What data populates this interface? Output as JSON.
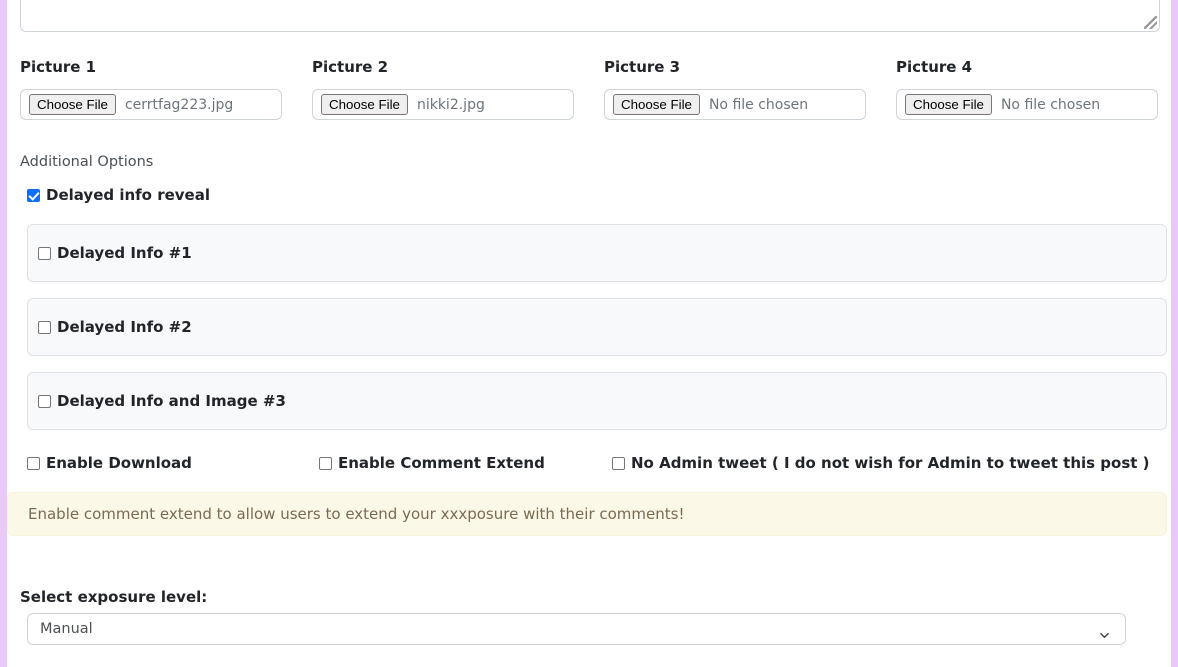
{
  "theme": {
    "page_border_color": "#e8c9f7",
    "accent_checkbox_color": "#0d6efd",
    "panel_bg": "#f8f9fa",
    "panel_border": "#dee2e6",
    "alert_bg": "#fcf8e8",
    "alert_text_color": "#7a6a52",
    "input_border": "#ced4da",
    "muted_text": "#6c757d"
  },
  "textarea": {
    "value": "",
    "placeholder": ""
  },
  "pictures": [
    {
      "label": "Picture 1",
      "button_label": "Choose File",
      "file_name": "cerrtfag223.jpg",
      "has_file": true
    },
    {
      "label": "Picture 2",
      "button_label": "Choose File",
      "file_name": "nikki2.jpg",
      "has_file": true
    },
    {
      "label": "Picture 3",
      "button_label": "Choose File",
      "file_name": "No file chosen",
      "has_file": false
    },
    {
      "label": "Picture 4",
      "button_label": "Choose File",
      "file_name": "No file chosen",
      "has_file": false
    }
  ],
  "additional_options": {
    "heading": "Additional Options",
    "delayed_info_reveal": {
      "label": "Delayed info reveal",
      "checked": true
    }
  },
  "delayed_panels": [
    {
      "label": "Delayed Info #1",
      "checked": false
    },
    {
      "label": "Delayed Info #2",
      "checked": false
    },
    {
      "label": "Delayed Info and Image #3",
      "checked": false
    }
  ],
  "option_checkboxes": [
    {
      "label": "Enable Download",
      "checked": false
    },
    {
      "label": "Enable Comment Extend",
      "checked": false
    },
    {
      "label": "No Admin tweet ( I do not wish for Admin to tweet this post )",
      "checked": false
    }
  ],
  "alert": {
    "message": "Enable comment extend to allow users to extend your xxxposure with their comments!"
  },
  "exposure_select": {
    "label": "Select exposure level:",
    "selected": "Manual",
    "icon": "chevron-down-icon"
  }
}
